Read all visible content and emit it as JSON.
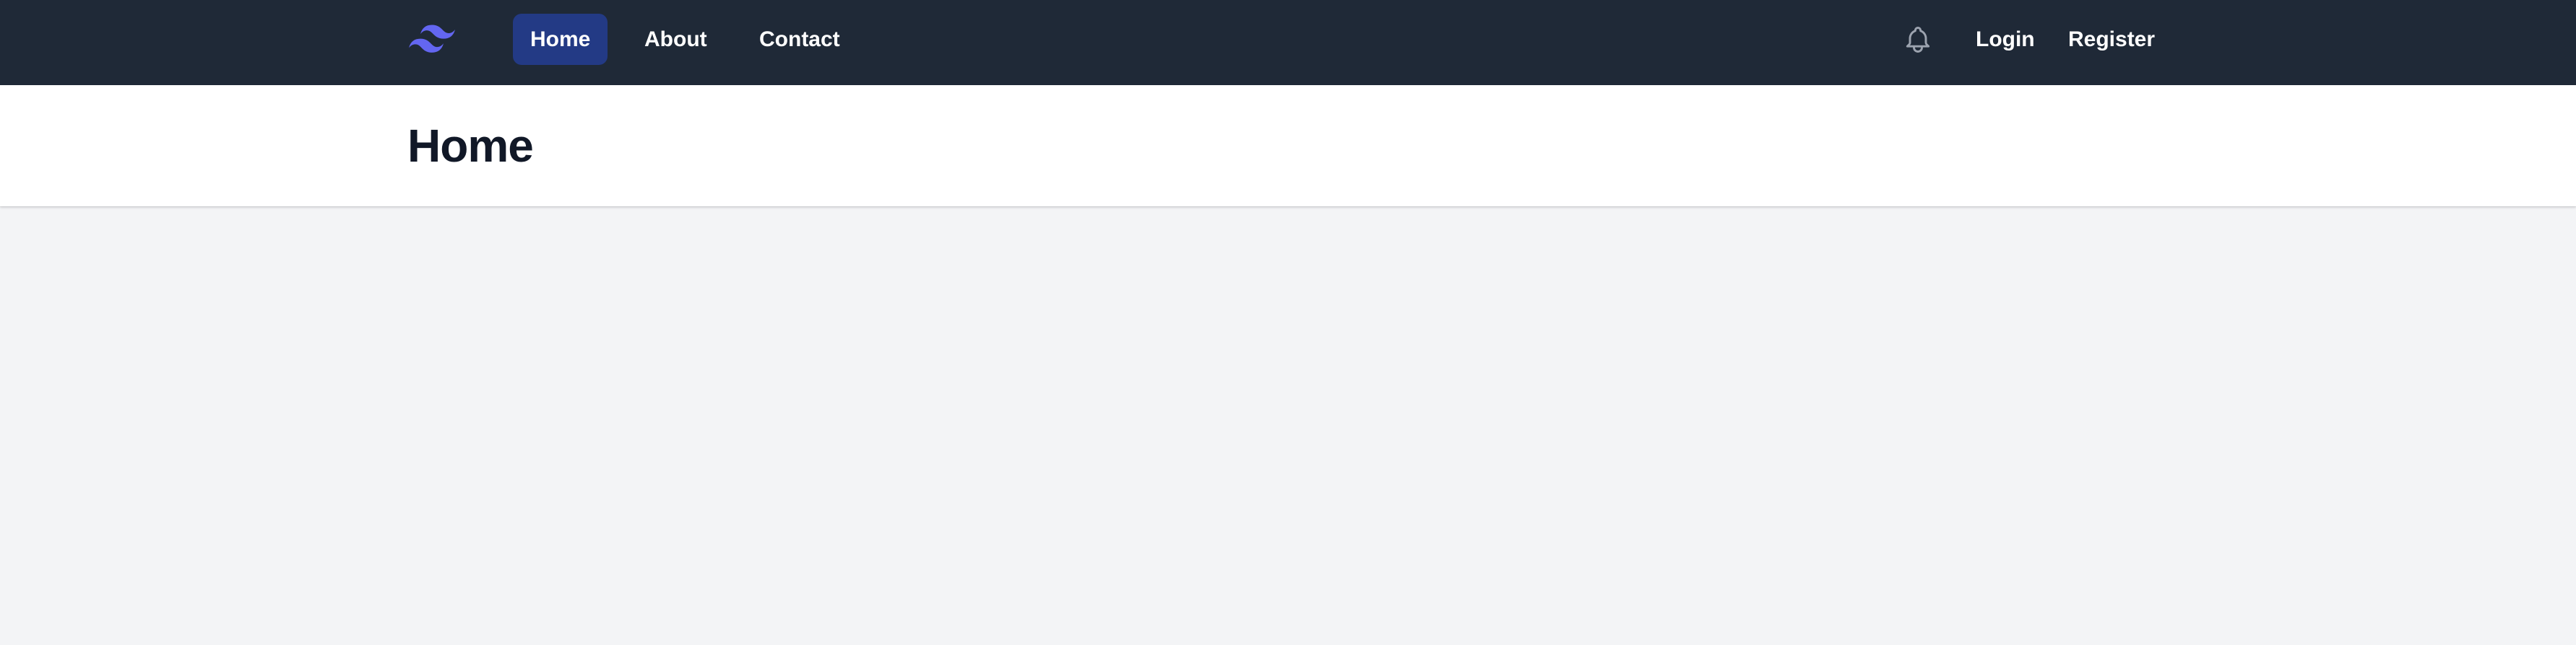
{
  "nav": {
    "logo_icon": "tailwind-logo-icon",
    "items": [
      {
        "label": "Home",
        "active": true
      },
      {
        "label": "About",
        "active": false
      },
      {
        "label": "Contact",
        "active": false
      }
    ],
    "notifications_icon": "bell-icon",
    "login_label": "Login",
    "register_label": "Register"
  },
  "header": {
    "title": "Home"
  },
  "colors": {
    "topbar_bg": "#1f2937",
    "active_nav_bg": "#233a85",
    "logo": "#6366f1",
    "page_bg": "#f3f4f6",
    "title_text": "#111827"
  }
}
